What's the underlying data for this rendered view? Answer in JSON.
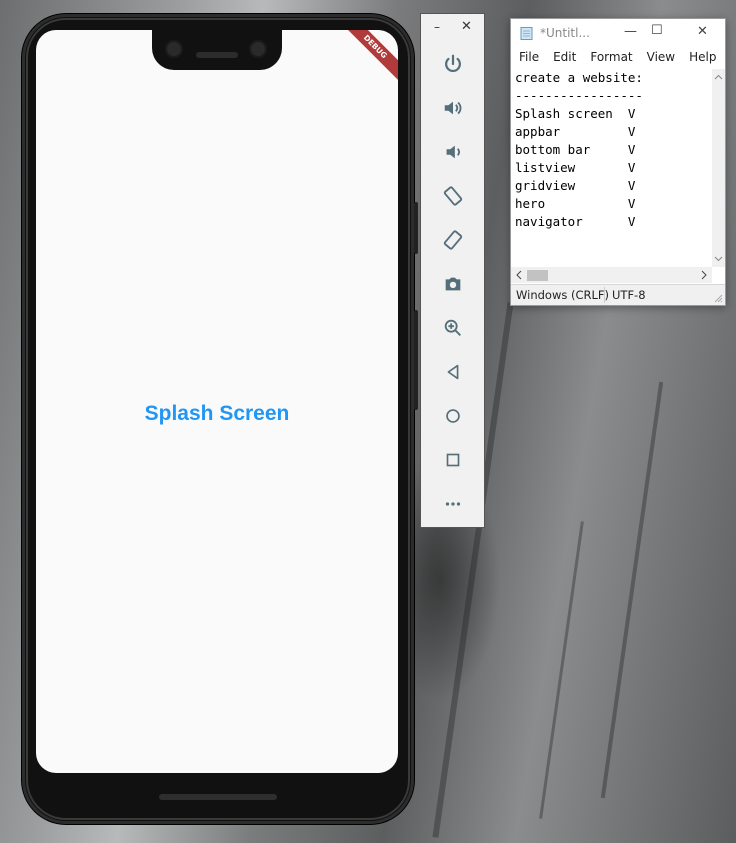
{
  "phone": {
    "splash_text": "Splash Screen",
    "debug_label": "DEBUG",
    "splash_color": "#2196f3"
  },
  "emulator": {
    "minimize_label": "–",
    "close_label": "✕",
    "buttons": [
      {
        "icon": "power-icon"
      },
      {
        "icon": "volume-up-icon"
      },
      {
        "icon": "volume-down-icon"
      },
      {
        "icon": "rotate-left-icon"
      },
      {
        "icon": "rotate-right-icon"
      },
      {
        "icon": "camera-icon"
      },
      {
        "icon": "zoom-icon"
      },
      {
        "icon": "back-icon"
      },
      {
        "icon": "home-icon"
      },
      {
        "icon": "overview-icon"
      },
      {
        "icon": "more-icon"
      }
    ]
  },
  "notepad": {
    "title": "*Untitl...",
    "menu": [
      "File",
      "Edit",
      "Format",
      "View",
      "Help"
    ],
    "lines": [
      "create a website:",
      "-----------------",
      "Splash screen  V",
      "appbar         V",
      "bottom bar     V",
      "listview       V",
      "gridview       V",
      "hero           V",
      "navigator      V"
    ],
    "status": {
      "line_ending": "Windows (CRLF)",
      "encoding": "UTF-8"
    }
  }
}
